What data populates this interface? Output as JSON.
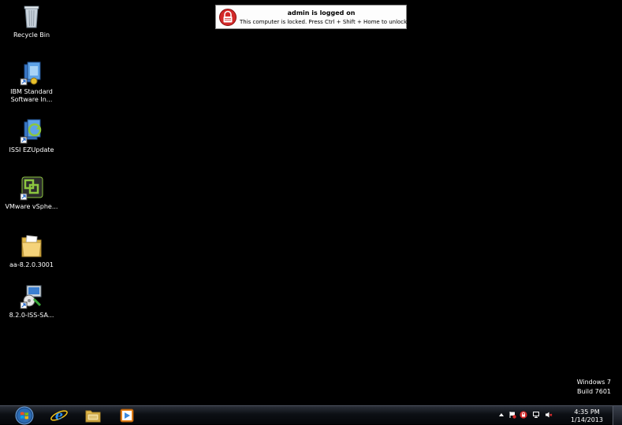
{
  "desktop_icons": [
    {
      "name": "recycle-bin",
      "label": "Recycle Bin",
      "icon": "recycle-bin-icon"
    },
    {
      "name": "ibm-standard-software",
      "label": "IBM Standard Software In...",
      "icon": "installer-icon"
    },
    {
      "name": "issi-ezupdate",
      "label": "ISSI EZUpdate",
      "icon": "update-icon"
    },
    {
      "name": "vmware-vsphere",
      "label": "VMware vSphe...",
      "icon": "vmware-icon"
    },
    {
      "name": "folder-aa",
      "label": "aa-8.2.0.3001",
      "icon": "folder-icon"
    },
    {
      "name": "iss-setup",
      "label": "8.2.0-ISS-SA...",
      "icon": "setup-icon"
    }
  ],
  "lock_notice": {
    "title": "admin is logged on",
    "message": "This computer is locked. Press Ctrl + Shift + Home to unlock."
  },
  "watermark": {
    "line1": "Windows 7",
    "line2": "Build 7601"
  },
  "taskbar": {
    "pinned": [
      "internet-explorer-icon",
      "windows-explorer-icon",
      "media-player-icon"
    ],
    "clock_time": "4:35 PM",
    "clock_date": "1/14/2013"
  },
  "colors": {
    "desktop_bg": "#000000",
    "lock_red": "#d42a2a"
  }
}
